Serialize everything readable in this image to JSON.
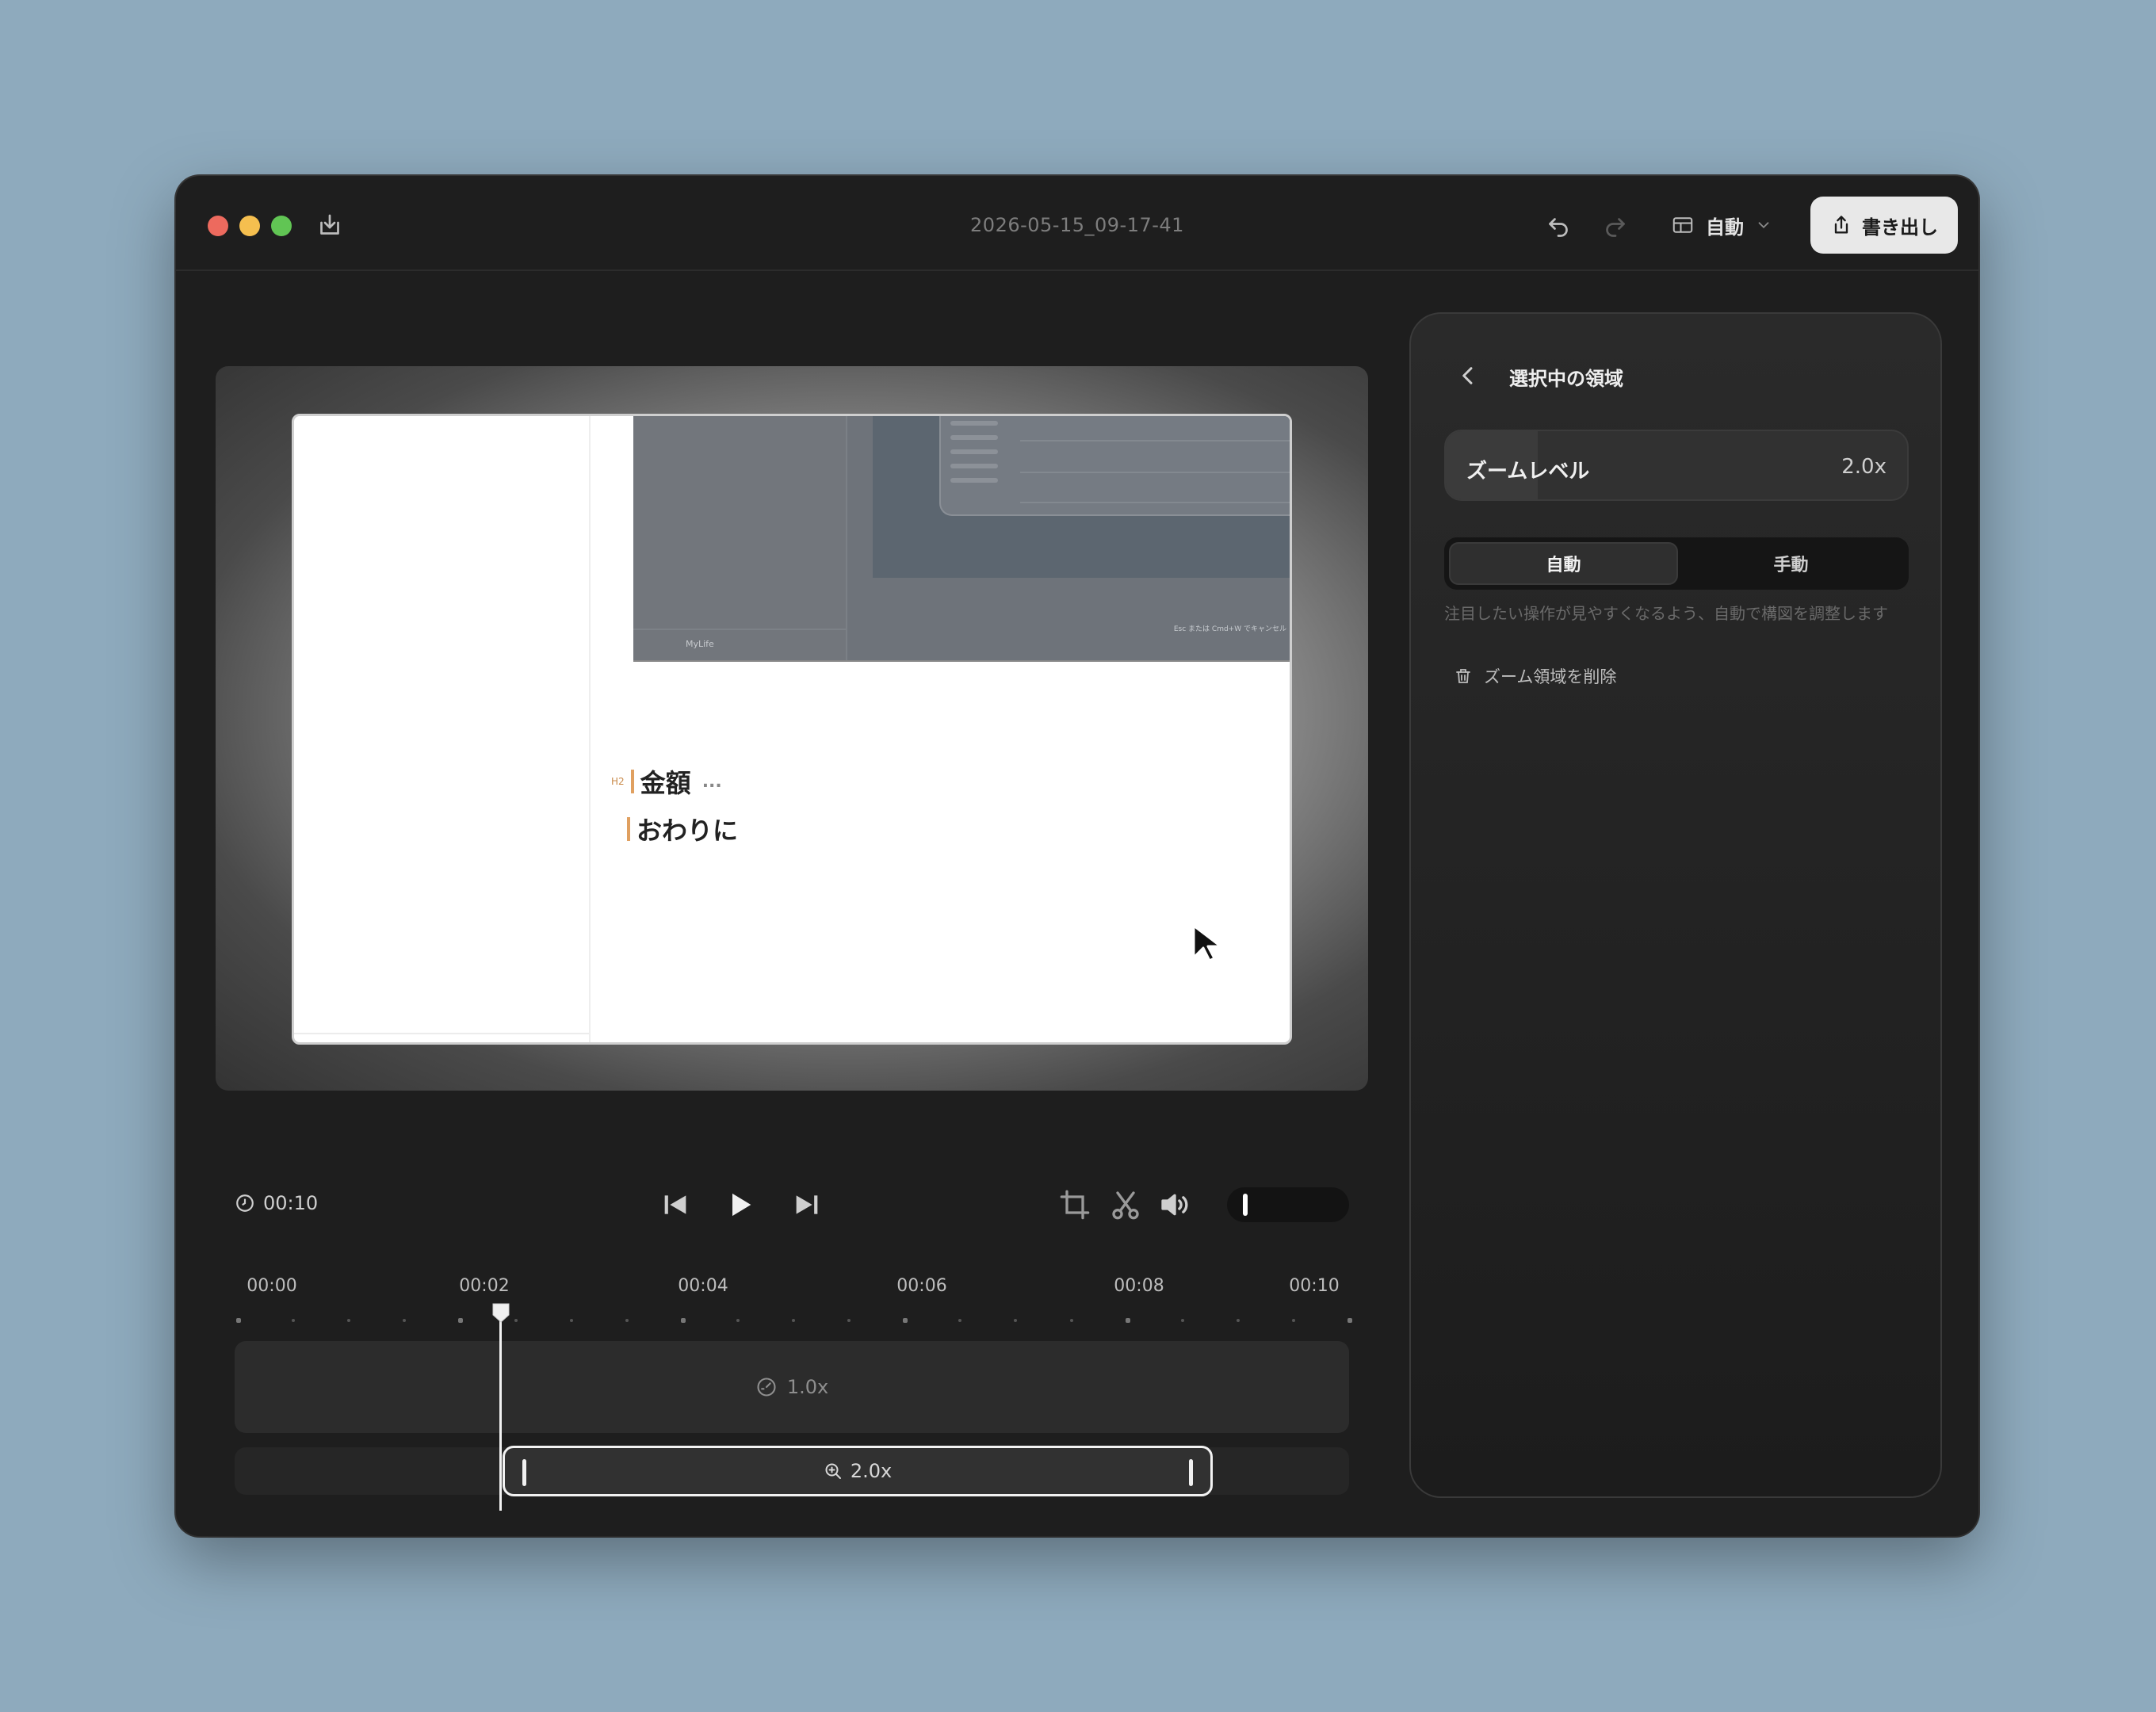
{
  "window": {
    "title": "2026-05-15_09-17-41",
    "layout_mode": "自動",
    "export_label": "書き出し"
  },
  "preview": {
    "heading_tag": "H2",
    "heading": "金額",
    "heading_more": "...",
    "subheading": "おわりに",
    "nested_footer": "MyLife",
    "nested_caption": "Esc または Cmd+W でキャンセル"
  },
  "player": {
    "duration": "00:10"
  },
  "timeline": {
    "ticks": [
      "00:00",
      "00:02",
      "00:04",
      "00:06",
      "00:08",
      "00:10"
    ],
    "speed_label": "1.0x",
    "zoom_label": "2.0x"
  },
  "panel": {
    "title": "選択中の領域",
    "zoom_level_label": "ズームレベル",
    "zoom_level_value": "2.0x",
    "zoom_level_fraction": 0.2,
    "modes": [
      "自動",
      "手動"
    ],
    "active_mode": "自動",
    "hint": "注目したい操作が見やすくなるよう、自動で構図を調整します",
    "delete_label": "ズーム領域を削除"
  },
  "colors": {
    "close": "#ed6a5e",
    "minimize": "#f5bf4f",
    "maximize": "#61c554",
    "heading_accent": "#e0a060"
  }
}
